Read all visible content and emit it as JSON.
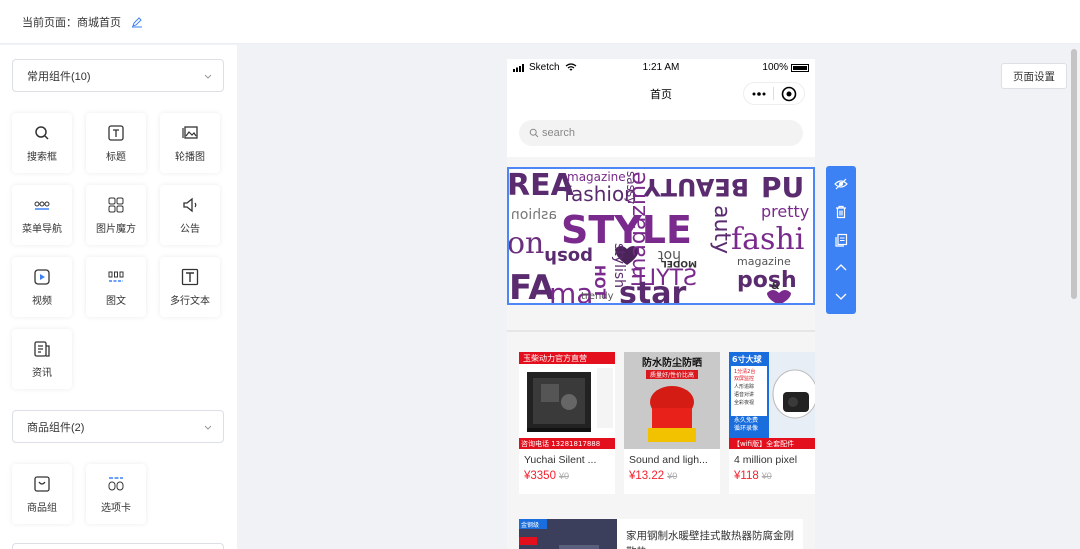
{
  "header": {
    "current_page_label": "当前页面：商城首页",
    "edit_icon": "edit-icon"
  },
  "sidebar": {
    "common_group": {
      "label": "常用组件(10)"
    },
    "common_components": [
      {
        "label": "搜索框",
        "icon": "search-icon"
      },
      {
        "label": "标题",
        "icon": "title-icon"
      },
      {
        "label": "轮播图",
        "icon": "carousel-icon"
      },
      {
        "label": "菜单导航",
        "icon": "menu-nav-icon"
      },
      {
        "label": "图片魔方",
        "icon": "image-cube-icon"
      },
      {
        "label": "公告",
        "icon": "announcement-icon"
      },
      {
        "label": "视频",
        "icon": "video-icon"
      },
      {
        "label": "图文",
        "icon": "image-text-icon"
      },
      {
        "label": "多行文本",
        "icon": "multiline-text-icon"
      },
      {
        "label": "资讯",
        "icon": "news-icon"
      }
    ],
    "goods_group": {
      "label": "商品组件(2)"
    },
    "goods_components": [
      {
        "label": "商品组",
        "icon": "goods-group-icon"
      },
      {
        "label": "选项卡",
        "icon": "tabs-icon"
      }
    ]
  },
  "phone": {
    "status": {
      "carrier": "Sketch",
      "time": "1:21 AM",
      "battery": "100%"
    },
    "nav_title": "首页",
    "search_placeholder": "search",
    "banner": {
      "words": [
        "magazine",
        "fashion",
        "BEAUTY",
        "STYLE",
        "pretty",
        "hot",
        "posh",
        "star",
        "trendy",
        "stylish",
        "MODEL",
        "magazine",
        "fashi",
        "posh",
        "HOT",
        "STYLE",
        "auty",
        "sassy",
        "ashion",
        "REA"
      ]
    },
    "goods": [
      {
        "name": "Yuchai Silent ...",
        "price": "¥3350",
        "original": "¥0",
        "img_text": "玉柴动力官方直营",
        "img_footer": "咨询电话 13281817888"
      },
      {
        "name": "Sound and ligh...",
        "price": "¥13.22",
        "original": "¥0",
        "img_text": "防水防尘防晒",
        "img_sub": "质量好/性价比高"
      },
      {
        "name": "4 million pixel",
        "price": "¥118",
        "original": "¥0",
        "img_text": "6寸大球",
        "img_lines": [
          "1分清2台",
          "双屏监控",
          "人形追踪",
          "语音对讲",
          "全彩夜视",
          "永久免费",
          "循环录像"
        ],
        "img_footer": "【wifi版】全套配件"
      }
    ],
    "news": {
      "title": "家用钢制水暖壁挂式散热器防腐金刚散热",
      "badge": "金钢级"
    }
  },
  "toolbar": {
    "icons": [
      "hide-icon",
      "delete-icon",
      "copy-icon",
      "move-up-icon",
      "move-down-icon"
    ]
  },
  "settings_button": "页面设置",
  "colors": {
    "accent": "#3d82f5",
    "price": "#f5222d",
    "banner_purple": "#7a2a8c"
  }
}
